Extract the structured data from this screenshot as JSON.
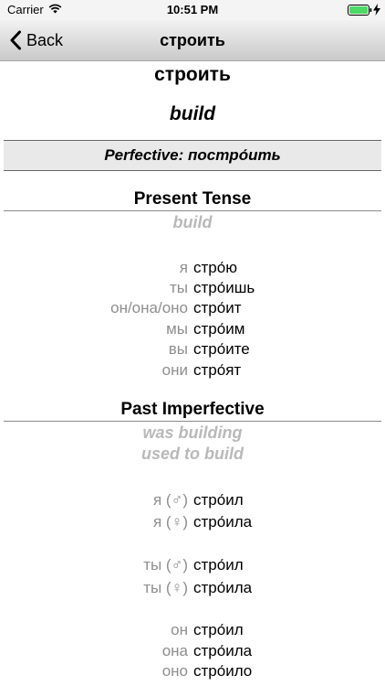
{
  "status": {
    "carrier": "Carrier",
    "time": "10:51 PM"
  },
  "nav": {
    "back_label": "Back",
    "title": "строить"
  },
  "verb": {
    "infinitive": "строить",
    "translation": "build"
  },
  "aspect_banner": "Perfective: постро́ить",
  "present": {
    "header": "Present Tense",
    "gloss": "build",
    "rows": [
      {
        "pronoun": "я",
        "form": "стро́ю"
      },
      {
        "pronoun": "ты",
        "form": "стро́ишь"
      },
      {
        "pronoun": "он/она/оно",
        "form": "стро́ит"
      },
      {
        "pronoun": "мы",
        "form": "стро́им"
      },
      {
        "pronoun": "вы",
        "form": "стро́ите"
      },
      {
        "pronoun": "они",
        "form": "стро́ят"
      }
    ]
  },
  "past": {
    "header": "Past Imperfective",
    "gloss_1": "was building",
    "gloss_2": "used to build",
    "rows": [
      {
        "pronoun": "я (♂)",
        "form": "стро́ил"
      },
      {
        "pronoun": "я (♀)",
        "form": "стро́ила"
      },
      {
        "pronoun": "ты (♂)",
        "form": "стро́ил"
      },
      {
        "pronoun": "ты (♀)",
        "form": "стро́ила"
      },
      {
        "pronoun": "он",
        "form": "стро́ил"
      },
      {
        "pronoun": "она",
        "form": "стро́ила"
      },
      {
        "pronoun": "оно",
        "form": "стро́ило"
      }
    ]
  }
}
